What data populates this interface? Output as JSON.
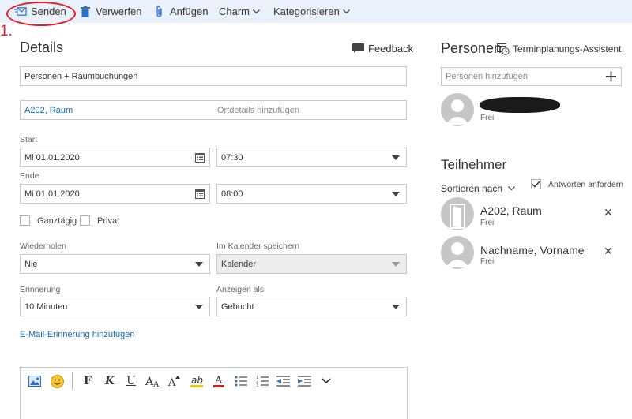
{
  "toolbar": {
    "send_label": "Senden",
    "discard_label": "Verwerfen",
    "attach_label": "Anfügen",
    "charm_label": "Charm",
    "categorize_label": "Kategorisieren"
  },
  "annotation": {
    "step_label": "1."
  },
  "details": {
    "title": "Details",
    "feedback_label": "Feedback",
    "subject_value": "Personen + Raumbuchungen",
    "location_value": "A202, Raum",
    "location_placeholder": "Ortdetails hinzufügen",
    "start_label": "Start",
    "start_date": "Mi 01.01.2020",
    "start_time": "07:30",
    "end_label": "Ende",
    "end_date": "Mi 01.01.2020",
    "end_time": "08:00",
    "all_day_label": "Ganztägig",
    "private_label": "Privat",
    "repeat_label": "Wiederholen",
    "repeat_value": "Nie",
    "save_in_label": "Im Kalender speichern",
    "save_in_value": "Kalender",
    "reminder_label": "Erinnerung",
    "reminder_value": "10 Minuten",
    "show_as_label": "Anzeigen als",
    "show_as_value": "Gebucht",
    "email_reminder_link": "E-Mail-Erinnerung hinzufügen"
  },
  "people": {
    "title": "Personen",
    "scheduling_assistant_label": "Terminplanungs-Assistent",
    "add_people_placeholder": "Personen hinzufügen",
    "organizer_status": "Frei"
  },
  "attendees": {
    "title": "Teilnehmer",
    "sort_label": "Sortieren nach",
    "request_responses_label": "Antworten anfordern",
    "items": [
      {
        "name": "A202, Raum",
        "status": "Frei",
        "type": "room"
      },
      {
        "name": "Nachname, Vorname",
        "status": "Frei",
        "type": "person"
      }
    ]
  },
  "editor_toolbar": {
    "bold_glyph": "F",
    "italic_glyph": "K",
    "underline_glyph": "U"
  },
  "colors": {
    "toolbar_bg": "#eaf1fb",
    "accent_blue": "#0f6cbd",
    "annotation_red": "#e0202a",
    "highlight_yellow": "#e8d000",
    "font_red": "#d02020"
  }
}
